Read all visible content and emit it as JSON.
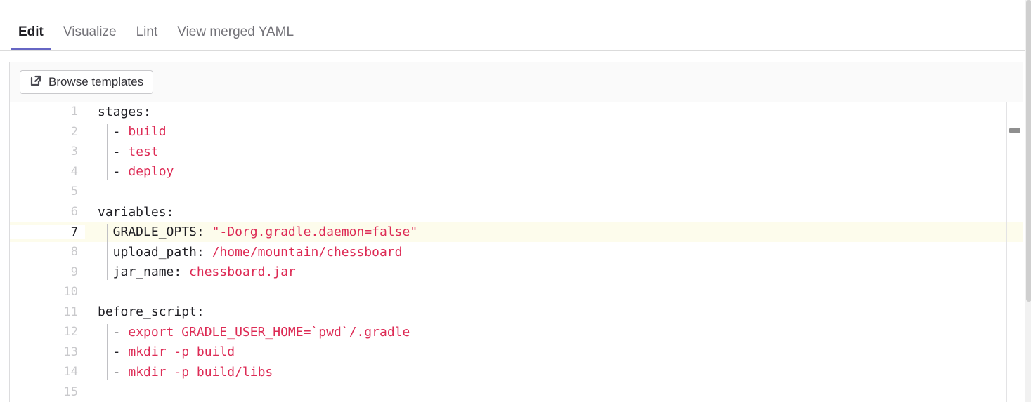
{
  "tabs": [
    {
      "label": "Edit",
      "active": true
    },
    {
      "label": "Visualize",
      "active": false
    },
    {
      "label": "Lint",
      "active": false
    },
    {
      "label": "View merged YAML",
      "active": false
    }
  ],
  "toolbar": {
    "browse_templates_label": "Browse templates",
    "browse_templates_icon": "external-link-icon"
  },
  "colors": {
    "accent": "#6666c4",
    "value_red": "#dd2b55",
    "key_text": "#1f1e24",
    "gutter_text": "#c9c9cc",
    "active_line_bg": "#fdfcec",
    "toolbar_bg": "#fafafa",
    "border": "#dcdcde"
  },
  "editor": {
    "language": "yaml",
    "active_line": 7,
    "lines": [
      {
        "num": "1",
        "key": "stages:",
        "value": ""
      },
      {
        "num": "2",
        "key": "  - ",
        "value": "build"
      },
      {
        "num": "3",
        "key": "  - ",
        "value": "test"
      },
      {
        "num": "4",
        "key": "  - ",
        "value": "deploy"
      },
      {
        "num": "5",
        "key": "",
        "value": ""
      },
      {
        "num": "6",
        "key": "variables:",
        "value": ""
      },
      {
        "num": "7",
        "key": "  GRADLE_OPTS: ",
        "value": "\"-Dorg.gradle.daemon=false\""
      },
      {
        "num": "8",
        "key": "  upload_path: ",
        "value": "/home/mountain/chessboard"
      },
      {
        "num": "9",
        "key": "  jar_name: ",
        "value": "chessboard.jar"
      },
      {
        "num": "10",
        "key": "",
        "value": ""
      },
      {
        "num": "11",
        "key": "before_script:",
        "value": ""
      },
      {
        "num": "12",
        "key": "  - ",
        "value": "export GRADLE_USER_HOME=`pwd`/.gradle"
      },
      {
        "num": "13",
        "key": "  - ",
        "value": "mkdir -p build"
      },
      {
        "num": "14",
        "key": "  - ",
        "value": "mkdir -p build/libs"
      },
      {
        "num": "15",
        "key": "",
        "value": ""
      }
    ]
  }
}
